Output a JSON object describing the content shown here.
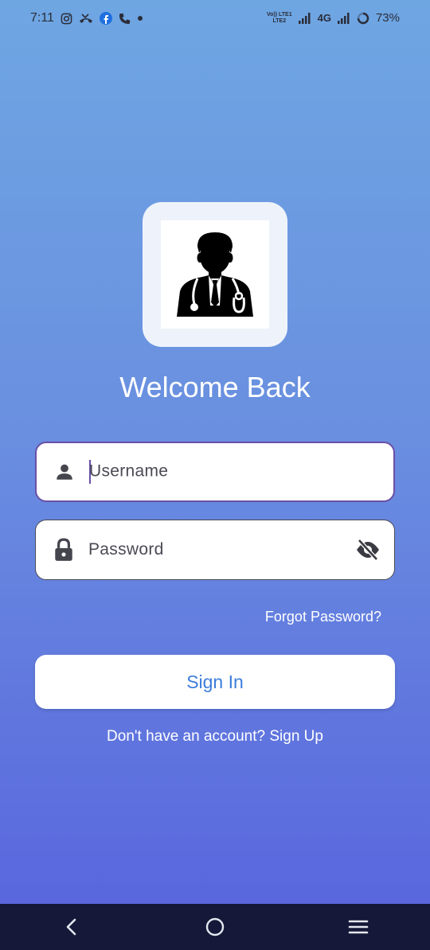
{
  "status_bar": {
    "time": "7:11",
    "network_top": "Vo)) LTE1",
    "network_bottom": "LTE2",
    "network_type": "4G",
    "battery": "73%",
    "icons": [
      "instagram-icon",
      "missed-call-icon",
      "facebook-icon",
      "phone-icon",
      "dot-icon",
      "signal-icon",
      "battery-ring-icon"
    ]
  },
  "app": {
    "logo_icon": "doctor-icon",
    "title": "Welcome Back"
  },
  "form": {
    "username_placeholder": "Username",
    "password_placeholder": "Password",
    "forgot_password": "Forgot Password?",
    "sign_in": "Sign In",
    "sign_up_prompt": "Don't have an account? Sign Up"
  },
  "colors": {
    "gradient_top": "#6ea6e2",
    "gradient_bottom": "#5863dd",
    "accent": "#3c7ddc",
    "focus_border": "#6a4fa5",
    "nav_bar": "#151838"
  },
  "nav_bar": {
    "buttons": [
      "back-icon",
      "home-icon",
      "recents-icon"
    ]
  }
}
